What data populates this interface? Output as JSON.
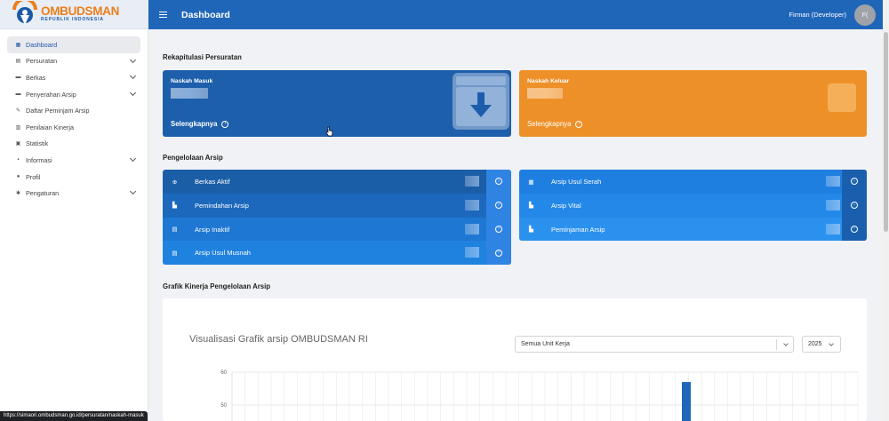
{
  "brand": {
    "title": "OMBUDSMAN",
    "subtitle": "REPUBLIK INDONESIA"
  },
  "header": {
    "page_title": "Dashboard",
    "user_name": "Firman (Developer)",
    "avatar_initials": "F("
  },
  "sidebar": {
    "items": [
      {
        "label": "Dashboard",
        "icon": "dashboard-icon",
        "glyph": "▦",
        "active": true,
        "has_children": false
      },
      {
        "label": "Persuratan",
        "icon": "mail-icon",
        "glyph": "▤",
        "active": false,
        "has_children": true
      },
      {
        "label": "Berkas",
        "icon": "folder-icon",
        "glyph": "▬",
        "active": false,
        "has_children": true
      },
      {
        "label": "Penyerahan Arsip",
        "icon": "folder-open-icon",
        "glyph": "▬",
        "active": false,
        "has_children": true
      },
      {
        "label": "Daftar Peminjam Arsip",
        "icon": "borrow-icon",
        "glyph": "✎",
        "active": false,
        "has_children": false
      },
      {
        "label": "Penilaian Kinerja",
        "icon": "bar-chart-icon",
        "glyph": "▥",
        "active": false,
        "has_children": false
      },
      {
        "label": "Statistik",
        "icon": "statistics-icon",
        "glyph": "▣",
        "active": false,
        "has_children": false
      },
      {
        "label": "Informasi",
        "icon": "info-icon",
        "glyph": "▪",
        "active": false,
        "has_children": true
      },
      {
        "label": "Profil",
        "icon": "user-icon",
        "glyph": "●",
        "active": false,
        "has_children": false
      },
      {
        "label": "Pengaturan",
        "icon": "gear-icon",
        "glyph": "✱",
        "active": false,
        "has_children": true
      }
    ]
  },
  "rekap": {
    "title": "Rekapitulasi Persuratan",
    "cards": [
      {
        "label": "Naskah Masuk",
        "link": "Selengkapnya",
        "icon": "download-box-icon",
        "color": "#1d5fab"
      },
      {
        "label": "Naskah Keluar",
        "link": "Selengkapnya",
        "icon": "upload-box-icon",
        "color": "#ee9028"
      }
    ]
  },
  "pengelolaan": {
    "title": "Pengelolaan Arsip",
    "left": [
      {
        "label": "Berkas Aktif",
        "icon": "plus-circle-icon",
        "glyph": "⊕"
      },
      {
        "label": "Pemindahan Arsip",
        "icon": "file-transfer-icon",
        "glyph": "▙"
      },
      {
        "label": "Arsip Inaktif",
        "icon": "archive-icon",
        "glyph": "▤"
      },
      {
        "label": "Arsip Usul Musnah",
        "icon": "file-delete-icon",
        "glyph": "▤"
      }
    ],
    "right": [
      {
        "label": "Arsip Usul Serah",
        "icon": "stack-icon",
        "glyph": "▦"
      },
      {
        "label": "Arsip Vital",
        "icon": "file-lock-icon",
        "glyph": "▙"
      },
      {
        "label": "Peminjaman Arsip",
        "icon": "file-user-icon",
        "glyph": "▙"
      }
    ]
  },
  "grafik": {
    "section_title": "Grafik Kinerja Pengelolaan Arsip",
    "chart_title": "Visualisasi Grafik arsip OMBUDSMAN RI",
    "unit_select": "Semua Unit Kerja",
    "year_select": "2025"
  },
  "chart_data": {
    "type": "bar",
    "title": "Visualisasi Grafik arsip OMBUDSMAN RI",
    "y_ticks": [
      60,
      50
    ],
    "ylim": [
      40,
      60
    ],
    "grid": true,
    "visible_bars": [
      {
        "slot": 17,
        "value": 57
      }
    ],
    "slots": 24
  },
  "status_bar": {
    "url": "https://simaori.ombudsman.go.id/persuratan/naskah-masuk"
  }
}
